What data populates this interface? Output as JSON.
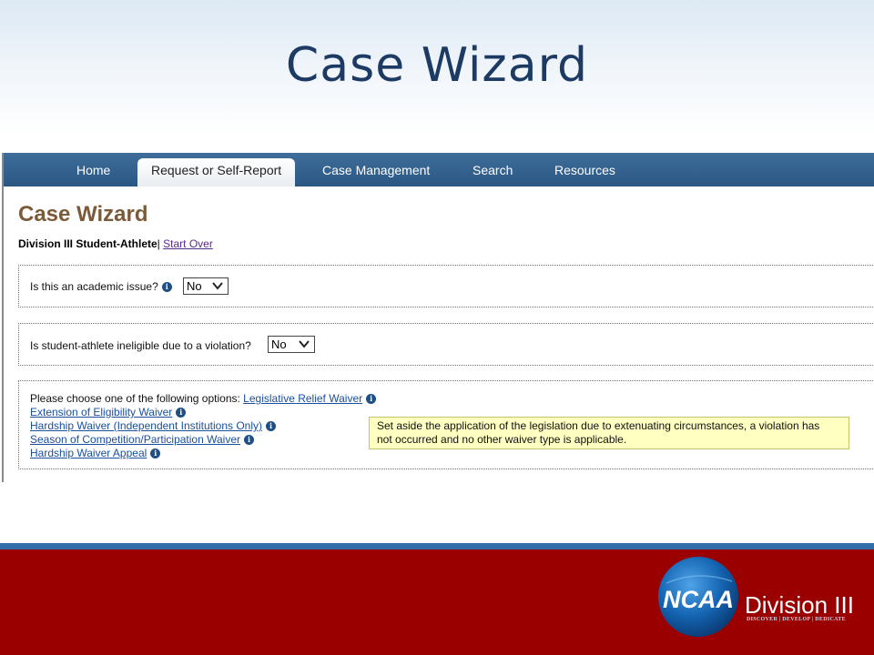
{
  "slide": {
    "title": "Case Wizard"
  },
  "nav": {
    "items": [
      "Home",
      "Request or Self-Report",
      "Case Management",
      "Search",
      "Resources"
    ],
    "active_index": 1
  },
  "page": {
    "heading": "Case Wizard",
    "breadcrumb_bold": "Division III Student-Athlete",
    "breadcrumb_sep": "|",
    "start_over": "Start Over"
  },
  "questions": [
    {
      "label": "Is this an academic issue?",
      "value": "No"
    },
    {
      "label": "Is student-athlete ineligible due to a violation?",
      "value": "No"
    }
  ],
  "options": {
    "prompt": "Please choose one of the following options:",
    "items": [
      "Legislative Relief Waiver",
      "Extension of Eligibility Waiver",
      "Hardship Waiver (Independent Institutions Only)",
      "Season of Competition/Participation Waiver",
      "Hardship Waiver Appeal"
    ],
    "tooltip_line1": "Set aside the application of the legislation due to extenuating circumstances, a violation has",
    "tooltip_line2": "not occurred and no other waiver type is applicable."
  },
  "branding": {
    "ncaa": "NCAA",
    "division": "Division III",
    "tagline": "DISCOVER | DEVELOP | DEDICATE",
    "colors": {
      "footer": "#9b0000",
      "accent": "#2f6ea6",
      "title": "#1c3a63"
    }
  },
  "icons": {
    "info": "info-icon",
    "dropdown": "chevron-down-icon"
  }
}
